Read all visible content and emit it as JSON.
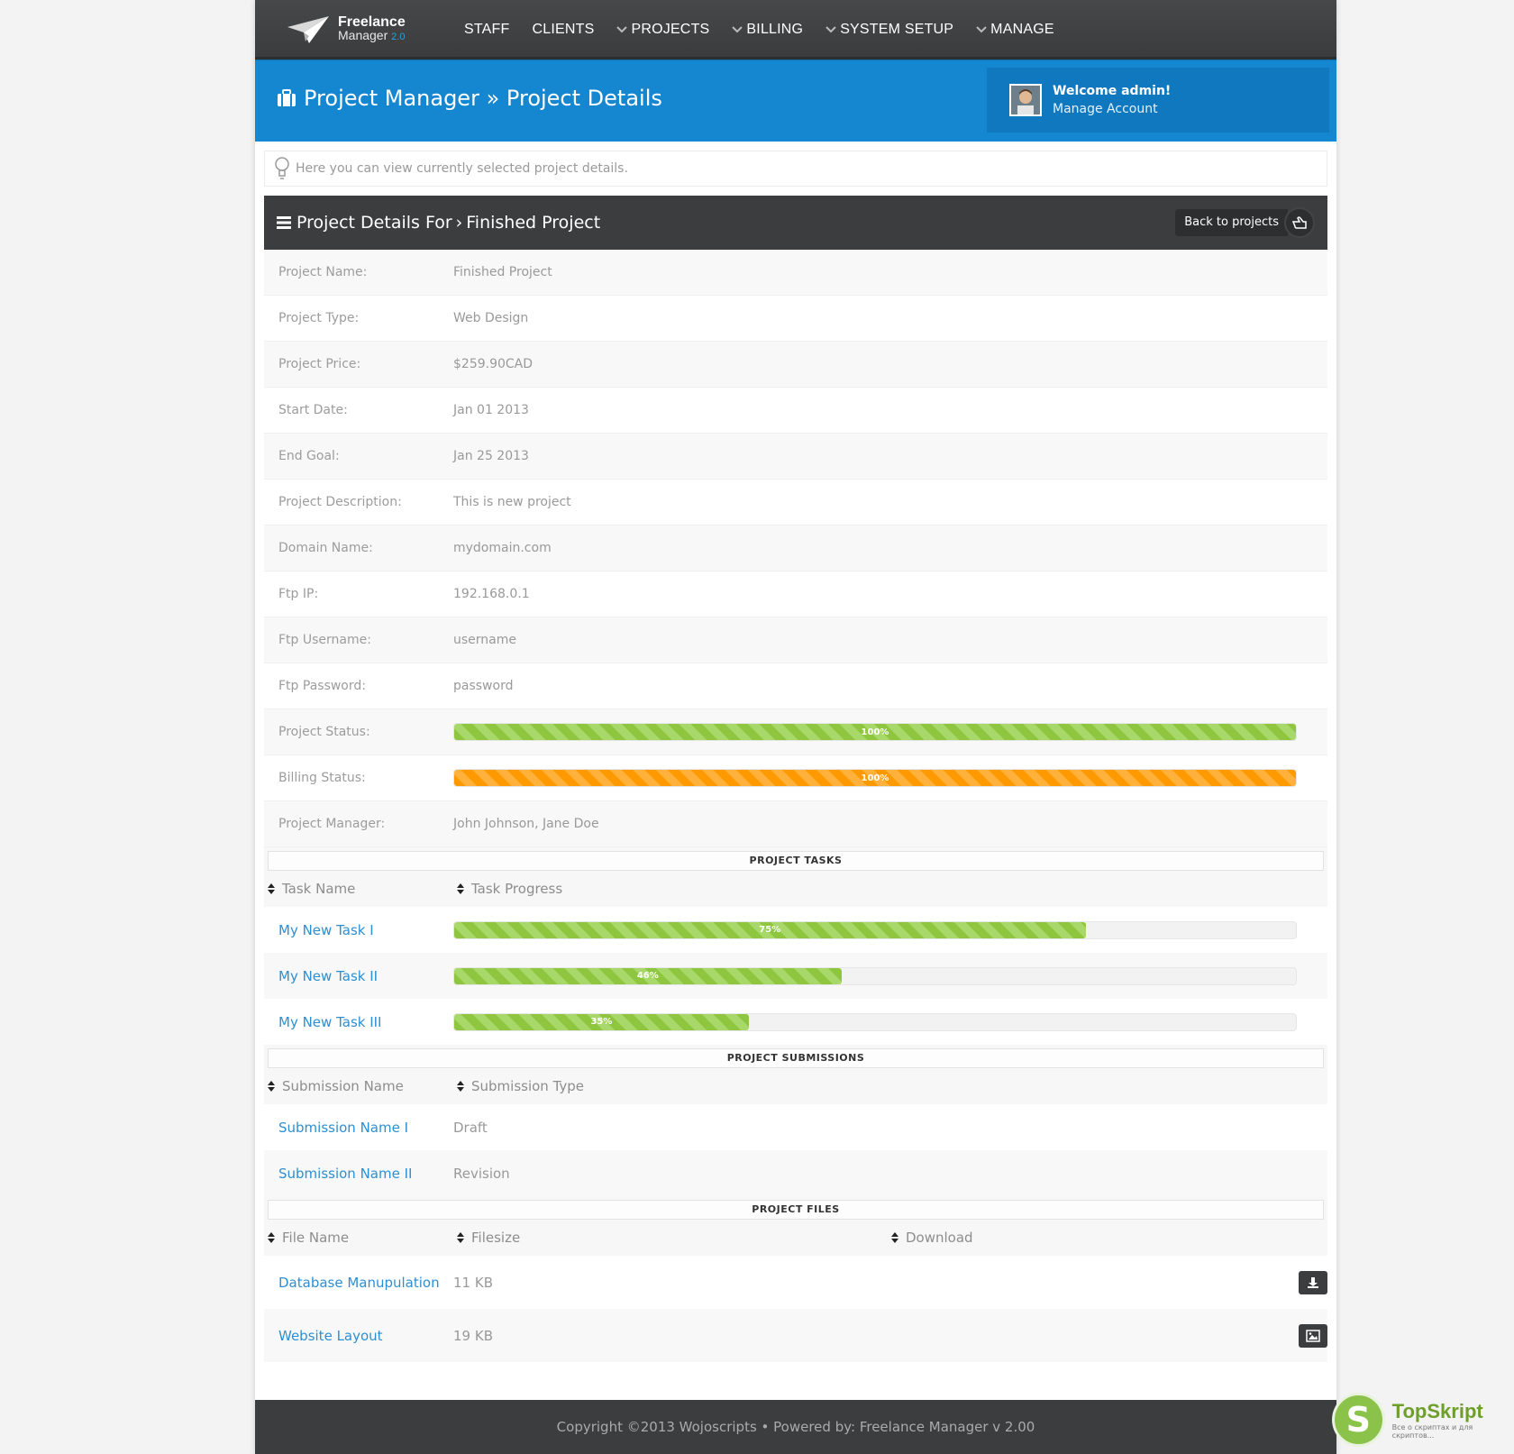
{
  "app": {
    "logo_line1": "Freelance",
    "logo_line2": "Manager",
    "logo_version": "2.0"
  },
  "nav": {
    "items": [
      {
        "label": "STAFF",
        "dropdown": false
      },
      {
        "label": "CLIENTS",
        "dropdown": false
      },
      {
        "label": "PROJECTS",
        "dropdown": true
      },
      {
        "label": "BILLING",
        "dropdown": true
      },
      {
        "label": "SYSTEM SETUP",
        "dropdown": true
      },
      {
        "label": "MANAGE",
        "dropdown": true
      }
    ]
  },
  "header": {
    "section": "Project Manager",
    "separator": "»",
    "page": "Project Details",
    "welcome": "Welcome admin!",
    "manage_account": "Manage Account"
  },
  "tip": {
    "text": "Here you can view currently selected project details."
  },
  "panel": {
    "title_prefix": "Project Details For",
    "crumb_sep": "›",
    "title_project": "Finished Project",
    "back_label": "Back to projects"
  },
  "details": [
    {
      "label": "Project Name:",
      "value": "Finished Project"
    },
    {
      "label": "Project Type:",
      "value": "Web Design"
    },
    {
      "label": "Project Price:",
      "value": "$259.90CAD"
    },
    {
      "label": "Start Date:",
      "value": "Jan 01 2013"
    },
    {
      "label": "End Goal:",
      "value": "Jan 25 2013"
    },
    {
      "label": "Project Description:",
      "value": "This is new project"
    },
    {
      "label": "Domain Name:",
      "value": "mydomain.com"
    },
    {
      "label": "Ftp IP:",
      "value": "192.168.0.1"
    },
    {
      "label": "Ftp Username:",
      "value": "username"
    },
    {
      "label": "Ftp Password:",
      "value": "password"
    }
  ],
  "status": {
    "project_label": "Project Status:",
    "project_value": 100,
    "project_text": "100%",
    "billing_label": "Billing Status:",
    "billing_value": 100,
    "billing_text": "100%",
    "manager_label": "Project Manager:",
    "manager_value": "John Johnson, Jane Doe"
  },
  "colors": {
    "accent": "#1586d0",
    "progress_green": "#8ec63f",
    "progress_orange": "#ff9900",
    "link": "#2d8fd1"
  },
  "tasks": {
    "section_title": "PROJECT TASKS",
    "col_name": "Task Name",
    "col_progress": "Task Progress",
    "rows": [
      {
        "name": "My New Task I",
        "progress": 75,
        "text": "75%"
      },
      {
        "name": "My New Task II",
        "progress": 46,
        "text": "46%"
      },
      {
        "name": "My New Task III",
        "progress": 35,
        "text": "35%"
      }
    ]
  },
  "submissions": {
    "section_title": "PROJECT SUBMISSIONS",
    "col_name": "Submission Name",
    "col_type": "Submission Type",
    "rows": [
      {
        "name": "Submission Name I",
        "type": "Draft"
      },
      {
        "name": "Submission Name II",
        "type": "Revision"
      }
    ]
  },
  "files": {
    "section_title": "PROJECT FILES",
    "col_name": "File Name",
    "col_size": "Filesize",
    "col_download": "Download",
    "rows": [
      {
        "name": "Database Manupulation",
        "size": "11 KB",
        "icon": "download-icon"
      },
      {
        "name": "Website Layout",
        "size": "19 KB",
        "icon": "image-icon"
      }
    ]
  },
  "footer": {
    "text": "Copyright ©2013 Wojoscripts • Powered by: Freelance Manager v 2.00"
  },
  "watermark": {
    "letter": "S",
    "brand": "TopSkript",
    "tagline": "Все о скриптах и для скриптов..."
  }
}
